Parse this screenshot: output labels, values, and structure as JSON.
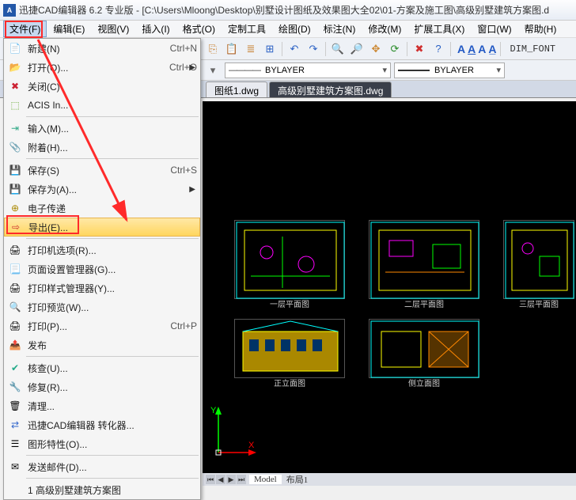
{
  "title": "迅捷CAD编辑器 6.2 专业版  - [C:\\Users\\Mloong\\Desktop\\别墅设计图纸及效果图大全02\\01-方案及施工图\\高级别墅建筑方案图.d",
  "menubar": {
    "file": "文件(F)",
    "edit": "编辑(E)",
    "view": "视图(V)",
    "insert": "插入(I)",
    "format": "格式(O)",
    "custom": "定制工具",
    "draw": "绘图(D)",
    "annotate": "标注(N)",
    "modify": "修改(M)",
    "extend": "扩展工具(X)",
    "window": "窗口(W)",
    "help": "帮助(H)"
  },
  "file_menu": {
    "new": {
      "label": "新建(N)",
      "shortcut": "Ctrl+N"
    },
    "open": {
      "label": "打开(O)...",
      "shortcut": "Ctrl+O"
    },
    "close": {
      "label": "关闭(C)"
    },
    "acis": {
      "label": "ACIS In..."
    },
    "input": {
      "label": "输入(M)..."
    },
    "attach": {
      "label": "附着(H)..."
    },
    "save": {
      "label": "保存(S)",
      "shortcut": "Ctrl+S"
    },
    "saveas": {
      "label": "保存为(A)..."
    },
    "etransmit": {
      "label": "电子传递"
    },
    "export": {
      "label": "导出(E)..."
    },
    "printopts": {
      "label": "打印机选项(R)..."
    },
    "pagesetup": {
      "label": "页面设置管理器(G)..."
    },
    "printstyle": {
      "label": "打印样式管理器(Y)..."
    },
    "printpreview": {
      "label": "打印预览(W)..."
    },
    "print": {
      "label": "打印(P)...",
      "shortcut": "Ctrl+P"
    },
    "publish": {
      "label": "发布"
    },
    "audit": {
      "label": "核查(U)..."
    },
    "recover": {
      "label": "修复(R)..."
    },
    "purge": {
      "label": "清理..."
    },
    "converter": {
      "label": "迅捷CAD编辑器 转化器..."
    },
    "drawprops": {
      "label": "图形特性(O)..."
    },
    "sendmail": {
      "label": "发送邮件(D)..."
    },
    "recent1": {
      "label": "1 高级别墅建筑方案图"
    }
  },
  "toolbar": {
    "dim_font": "DIM_FONT",
    "text_styles": [
      "A",
      "A",
      "A",
      "A"
    ]
  },
  "layer_bar": {
    "bylayer1": "BYLAYER",
    "bylayer2": "BYLAYER",
    "line_preview": "————"
  },
  "doc_tabs": {
    "tab1": "图纸1.dwg",
    "tab2": "高级别墅建筑方案图.dwg"
  },
  "canvas": {
    "y_axis": "Y",
    "x_axis": "X",
    "thumb_labels": [
      "一层平面图",
      "二层平面图",
      "三层平面图",
      "正立面图",
      "侧立面图"
    ]
  },
  "bottom_tabs": {
    "model": "Model",
    "layout1": "布局1"
  }
}
